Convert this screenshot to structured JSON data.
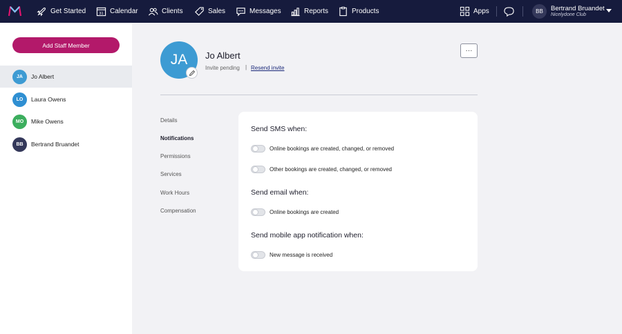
{
  "nav": {
    "items": [
      {
        "label": "Get Started",
        "icon": "rocket-icon"
      },
      {
        "label": "Calendar",
        "icon": "calendar-icon"
      },
      {
        "label": "Clients",
        "icon": "clients-icon"
      },
      {
        "label": "Sales",
        "icon": "tag-icon"
      },
      {
        "label": "Messages",
        "icon": "chat-icon"
      },
      {
        "label": "Reports",
        "icon": "chart-icon"
      },
      {
        "label": "Products",
        "icon": "clipboard-icon"
      }
    ],
    "apps_label": "Apps",
    "calendar_day": "31",
    "user": {
      "initials": "BB",
      "name": "Bertrand Bruandet",
      "club": "Nicelydone Club"
    }
  },
  "sidebar": {
    "add_button": "Add Staff Member",
    "staff": [
      {
        "initials": "JA",
        "name": "Jo Albert",
        "color": "#3d9bd3",
        "active": true
      },
      {
        "initials": "LO",
        "name": "Laura Owens",
        "color": "#2f8fd2",
        "active": false
      },
      {
        "initials": "MO",
        "name": "Mike Owens",
        "color": "#3cae5e",
        "active": false
      },
      {
        "initials": "BB",
        "name": "Bertrand Bruandet",
        "color": "#34385a",
        "active": false
      }
    ]
  },
  "profile": {
    "initials": "JA",
    "name": "Jo Albert",
    "status": "Invite pending",
    "separator": "|",
    "resend_link": "Resend invite",
    "more_label": "···"
  },
  "subnav": [
    "Details",
    "Notifications",
    "Permissions",
    "Services",
    "Work Hours",
    "Compensation"
  ],
  "subnav_active": "Notifications",
  "notifications": {
    "sms": {
      "title": "Send SMS when:",
      "options": [
        {
          "label": "Online bookings are created, changed, or removed",
          "enabled": false
        },
        {
          "label": "Other bookings are created, changed, or removed",
          "enabled": false
        }
      ]
    },
    "email": {
      "title": "Send email when:",
      "options": [
        {
          "label": "Online bookings are created",
          "enabled": false
        }
      ]
    },
    "mobile": {
      "title": "Send mobile app notification when:",
      "options": [
        {
          "label": "New message is received",
          "enabled": false
        }
      ]
    }
  },
  "colors": {
    "topbar": "#161b3d",
    "accent": "#b3196a",
    "link": "#1c2a7a"
  }
}
